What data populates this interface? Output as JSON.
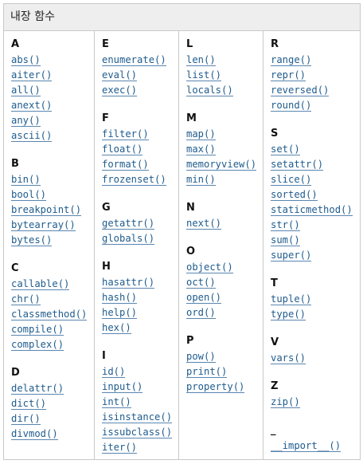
{
  "header": {
    "title": "내장 함수"
  },
  "columns": [
    {
      "groups": [
        {
          "letter": "A",
          "items": [
            "abs()",
            "aiter()",
            "all()",
            "anext()",
            "any()",
            "ascii()"
          ]
        },
        {
          "letter": "B",
          "items": [
            "bin()",
            "bool()",
            "breakpoint()",
            "bytearray()",
            "bytes()"
          ]
        },
        {
          "letter": "C",
          "items": [
            "callable()",
            "chr()",
            "classmethod()",
            "compile()",
            "complex()"
          ]
        },
        {
          "letter": "D",
          "items": [
            "delattr()",
            "dict()",
            "dir()",
            "divmod()"
          ]
        }
      ]
    },
    {
      "groups": [
        {
          "letter": "E",
          "items": [
            "enumerate()",
            "eval()",
            "exec()"
          ]
        },
        {
          "letter": "F",
          "items": [
            "filter()",
            "float()",
            "format()",
            "frozenset()"
          ]
        },
        {
          "letter": "G",
          "items": [
            "getattr()",
            "globals()"
          ]
        },
        {
          "letter": "H",
          "items": [
            "hasattr()",
            "hash()",
            "help()",
            "hex()"
          ]
        },
        {
          "letter": "I",
          "items": [
            "id()",
            "input()",
            "int()",
            "isinstance()",
            "issubclass()",
            "iter()"
          ]
        }
      ]
    },
    {
      "groups": [
        {
          "letter": "L",
          "items": [
            "len()",
            "list()",
            "locals()"
          ]
        },
        {
          "letter": "M",
          "items": [
            "map()",
            "max()",
            "memoryview()",
            "min()"
          ]
        },
        {
          "letter": "N",
          "items": [
            "next()"
          ]
        },
        {
          "letter": "O",
          "items": [
            "object()",
            "oct()",
            "open()",
            "ord()"
          ]
        },
        {
          "letter": "P",
          "items": [
            "pow()",
            "print()",
            "property()"
          ]
        }
      ]
    },
    {
      "groups": [
        {
          "letter": "R",
          "items": [
            "range()",
            "repr()",
            "reversed()",
            "round()"
          ]
        },
        {
          "letter": "S",
          "items": [
            "set()",
            "setattr()",
            "slice()",
            "sorted()",
            "staticmethod()",
            "str()",
            "sum()",
            "super()"
          ]
        },
        {
          "letter": "T",
          "items": [
            "tuple()",
            "type()"
          ]
        },
        {
          "letter": "V",
          "items": [
            "vars()"
          ]
        },
        {
          "letter": "Z",
          "items": [
            "zip()"
          ]
        },
        {
          "letter": "_",
          "items": [
            "__import__()"
          ]
        }
      ]
    }
  ]
}
